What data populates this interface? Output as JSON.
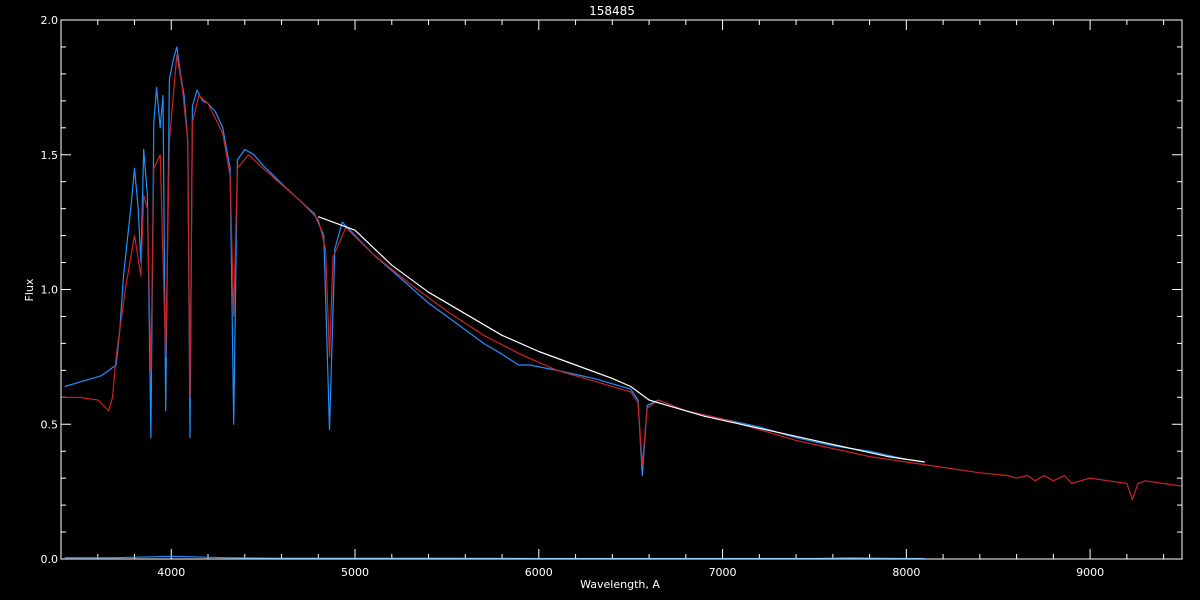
{
  "chart_data": {
    "type": "line",
    "title": "158485",
    "xlabel": "Wavelength, A",
    "ylabel": "Flux",
    "xlim": [
      3400,
      9500
    ],
    "ylim": [
      0.0,
      2.0
    ],
    "x_ticks": [
      4000,
      5000,
      6000,
      7000,
      8000,
      9000
    ],
    "x_tick_labels": [
      "4000",
      "5000",
      "6000",
      "7000",
      "8000",
      "9000"
    ],
    "y_ticks": [
      0.0,
      0.5,
      1.0,
      1.5,
      2.0
    ],
    "y_tick_labels": [
      "0.0",
      "0.5",
      "1.0",
      "1.5",
      "2.0"
    ],
    "grid": false,
    "background": "#000000",
    "foreground": "#ffffff",
    "series": [
      {
        "color": "#1e90ff",
        "x": [
          3420,
          3470,
          3520,
          3570,
          3620,
          3660,
          3700,
          3720,
          3740,
          3760,
          3780,
          3800,
          3820,
          3835,
          3850,
          3870,
          3889,
          3905,
          3920,
          3940,
          3955,
          3970,
          3990,
          4010,
          4030,
          4050,
          4070,
          4090,
          4102,
          4115,
          4140,
          4170,
          4200,
          4240,
          4280,
          4320,
          4340,
          4360,
          4400,
          4450,
          4500,
          4560,
          4620,
          4700,
          4780,
          4830,
          4861,
          4890,
          4930,
          5000,
          5100,
          5200,
          5300,
          5400,
          5500,
          5600,
          5700,
          5800,
          5890,
          5950,
          6100,
          6300,
          6500,
          6540,
          6563,
          6590,
          6650,
          6800,
          7000,
          7200,
          7400,
          7600,
          7800,
          8000,
          8100
        ],
        "y": [
          0.64,
          0.65,
          0.66,
          0.67,
          0.68,
          0.7,
          0.72,
          0.85,
          1.05,
          1.18,
          1.3,
          1.45,
          1.3,
          1.1,
          1.52,
          1.35,
          0.45,
          1.62,
          1.75,
          1.6,
          1.72,
          0.55,
          1.78,
          1.85,
          1.9,
          1.8,
          1.72,
          1.55,
          0.45,
          1.68,
          1.74,
          1.7,
          1.69,
          1.66,
          1.6,
          1.45,
          0.5,
          1.48,
          1.52,
          1.5,
          1.46,
          1.42,
          1.38,
          1.33,
          1.28,
          1.2,
          0.48,
          1.15,
          1.25,
          1.2,
          1.13,
          1.07,
          1.01,
          0.95,
          0.9,
          0.85,
          0.8,
          0.76,
          0.72,
          0.72,
          0.7,
          0.67,
          0.63,
          0.59,
          0.31,
          0.57,
          0.59,
          0.55,
          0.52,
          0.49,
          0.45,
          0.42,
          0.4,
          0.37,
          0.36
        ]
      },
      {
        "color": "#cc2222",
        "x": [
          3400,
          3500,
          3600,
          3660,
          3680,
          3700,
          3750,
          3800,
          3835,
          3850,
          3870,
          3889,
          3905,
          3940,
          3970,
          3990,
          4030,
          4060,
          4090,
          4102,
          4115,
          4150,
          4200,
          4280,
          4320,
          4340,
          4360,
          4420,
          4500,
          4600,
          4700,
          4800,
          4840,
          4861,
          4880,
          4950,
          5100,
          5300,
          5500,
          5700,
          5900,
          6100,
          6300,
          6500,
          6540,
          6563,
          6590,
          6650,
          6800,
          7000,
          7200,
          7400,
          7600,
          7800,
          8000,
          8200,
          8400,
          8550,
          8600,
          8660,
          8700,
          8750,
          8800,
          8860,
          8900,
          9000,
          9100,
          9200,
          9230,
          9260,
          9300,
          9400,
          9500
        ],
        "y": [
          0.6,
          0.6,
          0.59,
          0.55,
          0.6,
          0.75,
          1.0,
          1.2,
          1.05,
          1.35,
          1.3,
          0.7,
          1.45,
          1.5,
          0.75,
          1.55,
          1.87,
          1.75,
          1.55,
          0.6,
          1.62,
          1.72,
          1.69,
          1.58,
          1.42,
          0.9,
          1.45,
          1.5,
          1.45,
          1.39,
          1.33,
          1.26,
          1.15,
          0.75,
          1.12,
          1.23,
          1.13,
          1.02,
          0.92,
          0.83,
          0.76,
          0.7,
          0.66,
          0.62,
          0.58,
          0.35,
          0.56,
          0.59,
          0.55,
          0.52,
          0.48,
          0.44,
          0.41,
          0.38,
          0.36,
          0.34,
          0.32,
          0.31,
          0.3,
          0.31,
          0.29,
          0.31,
          0.29,
          0.31,
          0.28,
          0.3,
          0.29,
          0.28,
          0.22,
          0.28,
          0.29,
          0.28,
          0.27
        ]
      },
      {
        "color": "#ffffff",
        "x": [
          4800,
          5000,
          5200,
          5400,
          5600,
          5800,
          6000,
          6200,
          6400,
          6500,
          6600,
          6700,
          6900,
          7100,
          7300,
          7500,
          7700,
          7900,
          8100
        ],
        "y": [
          1.27,
          1.22,
          1.09,
          0.99,
          0.91,
          0.83,
          0.77,
          0.72,
          0.67,
          0.64,
          0.59,
          0.57,
          0.53,
          0.5,
          0.47,
          0.44,
          0.41,
          0.38,
          0.36
        ]
      },
      {
        "color": "#1e90ff",
        "x": [
          3420,
          3700,
          4000,
          4300,
          4600,
          5000,
          5500,
          6000,
          6500,
          7000,
          7500,
          7700,
          8000,
          8100
        ],
        "y": [
          0.005,
          0.005,
          0.01,
          0.005,
          0.003,
          0.003,
          0.003,
          0.002,
          0.002,
          0.002,
          0.002,
          0.004,
          0.002,
          0.002
        ]
      }
    ]
  }
}
